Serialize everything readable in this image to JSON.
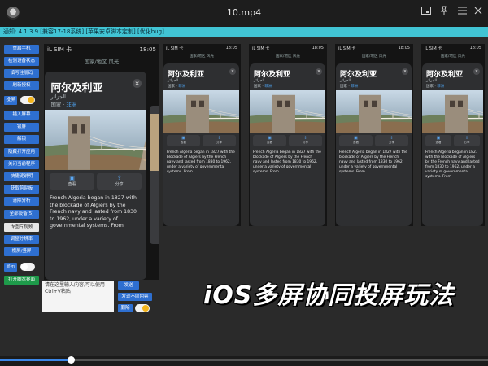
{
  "window": {
    "title": "10.mp4",
    "controls": [
      "picture-in-picture-icon",
      "pin-icon",
      "menu-icon",
      "minimize-icon",
      "close-icon"
    ]
  },
  "status_strip": {
    "text": "通知: 4.1.3.9 [兼容17-18系统] [苹果安卓脚本定制] [优化bug]"
  },
  "sidebar": {
    "buttons": [
      "重启手机",
      "检测设备状态",
      "填写注册码",
      "刷新授权",
      "投屏",
      "插入屏幕",
      "锁屏",
      "解锁",
      "隐藏打开应用",
      "关闭当前程序",
      "快捷键说明",
      "获取剪贴板",
      "清除分析",
      "全部设备(5)",
      "传图片视频",
      "调整分辨率",
      "横屏/竖屏",
      "显示",
      "打开脚本界面"
    ],
    "white_button_index": 14,
    "green_button_index": 18,
    "toggle_1_label": "投屏",
    "toggle_2_label": "显示"
  },
  "phone_main": {
    "status_time": "18:05",
    "status_left": "iL SIM 卡",
    "tabs_label": "国家/地区 风光",
    "card_title": "阿尔及利亚",
    "card_subtitle": "الجزائر",
    "meta_label": "国家",
    "meta_link": "非洲",
    "action_left": "查看",
    "action_right": "分享",
    "body": "French Algeria began in 1827 with the blockade of Algiers by the French navy and lasted from 1830 to 1962, under a variety of governmental systems. From"
  },
  "phone_mirror": {
    "status_time": "18:05",
    "status_left": "iL SIM 卡",
    "tabs_label": "国家/地区 风光",
    "card_title": "阿尔及利亚",
    "card_subtitle": "الجزائر",
    "meta_label": "国家",
    "meta_link": "非洲",
    "action_left": "查看",
    "action_right": "分享",
    "body": "French Algeria began in 1827 with the blockade of Algiers by the French navy and lasted from 1830 to 1962, under a variety of governmental systems. From"
  },
  "bottom": {
    "note_text": "请在这里输入内容,可以使用Ctrl+V粘贴",
    "send_label": "发送",
    "send_all_label": "发送不同内容",
    "delete_label": "删除",
    "headline": "iOS多屏协同投屏玩法"
  },
  "player": {
    "progress": 0.145
  },
  "colors": {
    "accent_blue": "#2e6fd0",
    "strip_cyan": "#41c4d4",
    "link_blue": "#4ea3f0",
    "toggle_knob": "#f3b41c"
  }
}
